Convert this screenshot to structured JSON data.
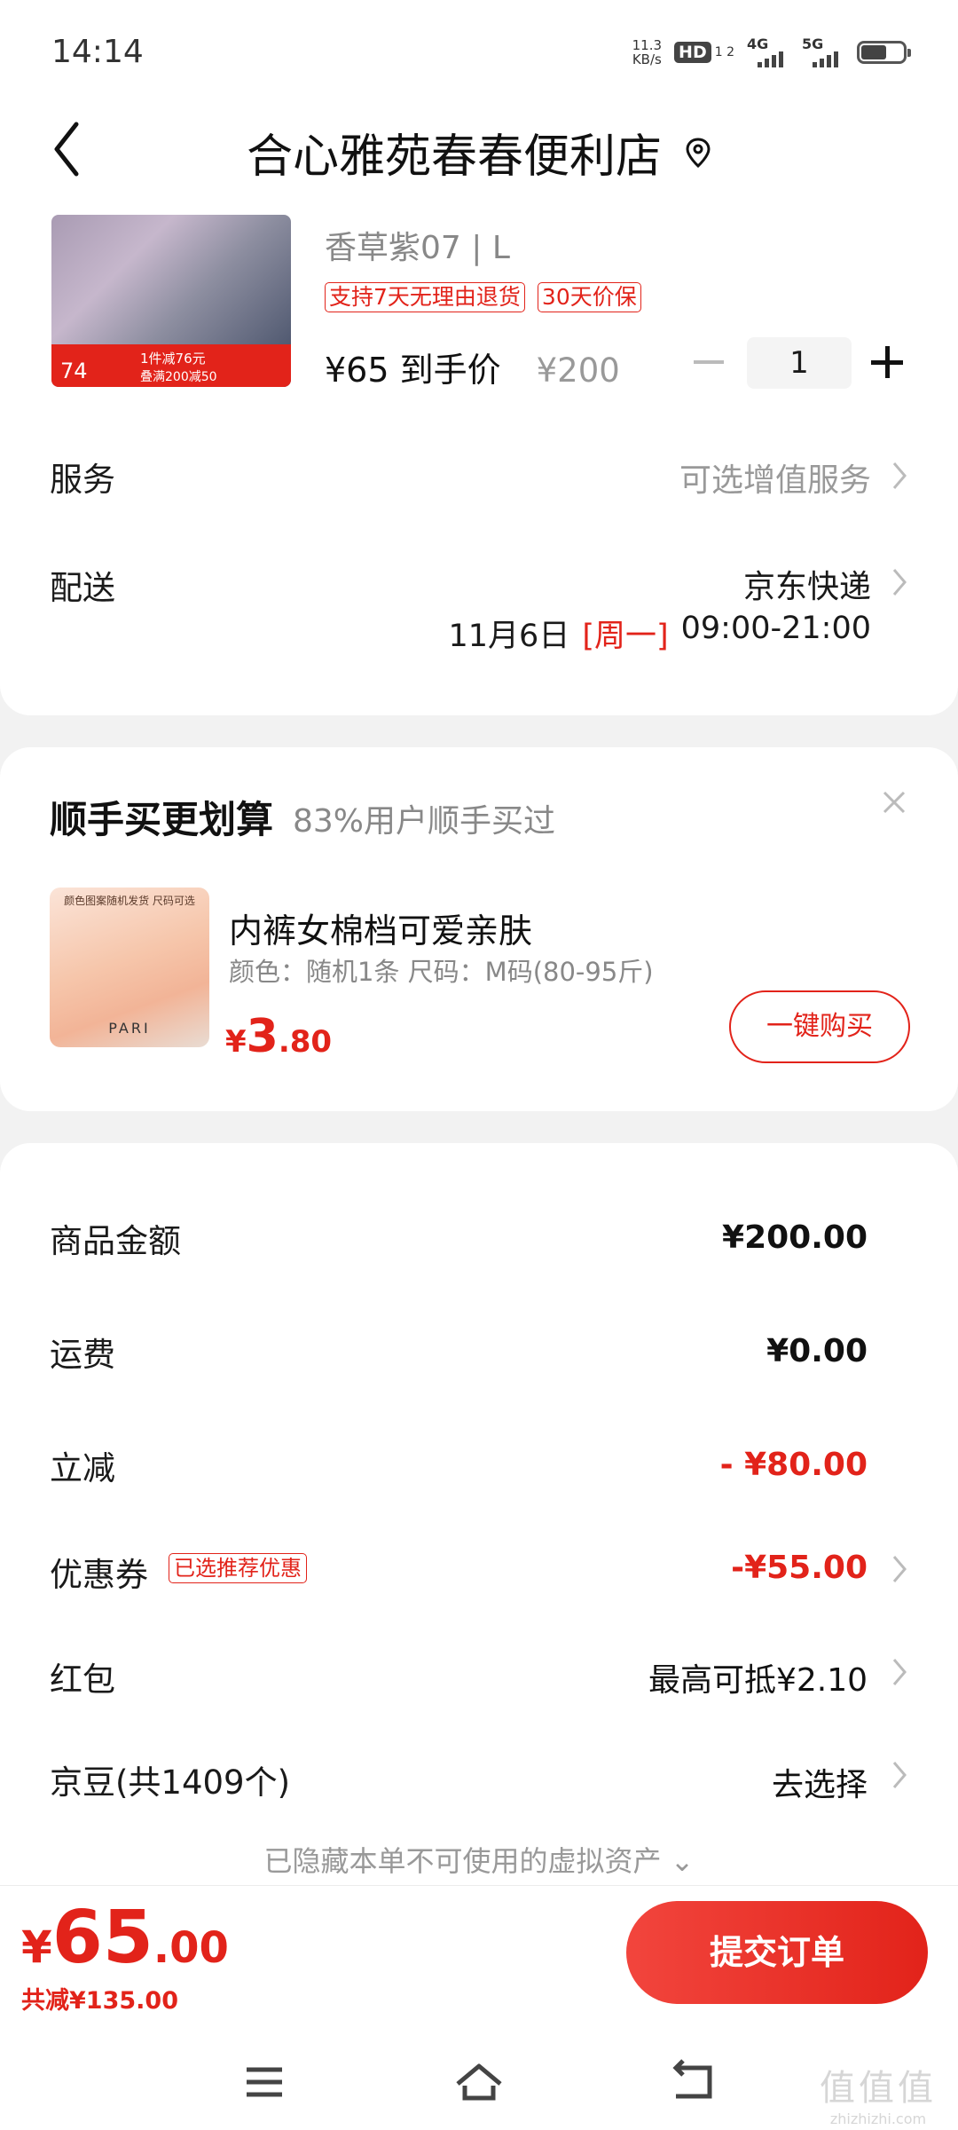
{
  "status_bar": {
    "time": "14:14",
    "net_speed_value": "11.3",
    "net_speed_unit": "KB/s",
    "hd_label": "HD",
    "hd_sub": "1 2",
    "net1": "4G",
    "net2": "5G"
  },
  "header": {
    "shop_name": "合心雅苑春春便利店"
  },
  "product": {
    "image_promo_number": "74",
    "image_promo_text1": "1件减76元",
    "image_promo_text2": "叠满200减50",
    "sku": "香草紫07 | L",
    "tags": [
      "支持7天无理由退货",
      "30天价保"
    ],
    "price_text": "¥65 到手价",
    "original_price": "¥200",
    "quantity": "1"
  },
  "service": {
    "label": "服务",
    "value": "可选增值服务"
  },
  "delivery": {
    "label": "配送",
    "carrier": "京东快递",
    "date": "11月6日",
    "weekday": "[周一]",
    "time_window": "09:00-21:00"
  },
  "upsell": {
    "title": "顺手买更划算",
    "subtitle": "83%用户顺手买过",
    "image_caption": "颜色图案随机发货 尺码可选",
    "image_logo": "PARI",
    "name": "内裤女棉档可爱亲肤",
    "spec": "颜色：随机1条   尺码：M码(80-95斤)",
    "price_currency": "¥",
    "price_int": "3",
    "price_dec": ".80",
    "buy_button": "一键购买"
  },
  "summary": {
    "goods_amount_label": "商品金额",
    "goods_amount": "¥200.00",
    "shipping_label": "运费",
    "shipping": "¥0.00",
    "instant_discount_label": "立减",
    "instant_discount": "- ¥80.00",
    "coupon_label": "优惠券",
    "coupon_tag": "已选推荐优惠",
    "coupon_value": "-¥55.00",
    "red_packet_label": "红包",
    "red_packet_value": "最高可抵¥2.10",
    "jd_beans_label": "京豆(共1409个)",
    "jd_beans_value": "去选择",
    "hidden_assets": "已隐藏本单不可使用的虚拟资产 ⌄"
  },
  "footer": {
    "total_currency": "¥",
    "total_int": "65",
    "total_dec": ".00",
    "saved": "共减¥135.00",
    "submit_button": "提交订单"
  },
  "watermark": {
    "big": "值值值",
    "small": "zhizhizhi.com"
  },
  "colors": {
    "accent": "#e2231a",
    "muted": "#888888",
    "background": "#f2f2f2"
  }
}
